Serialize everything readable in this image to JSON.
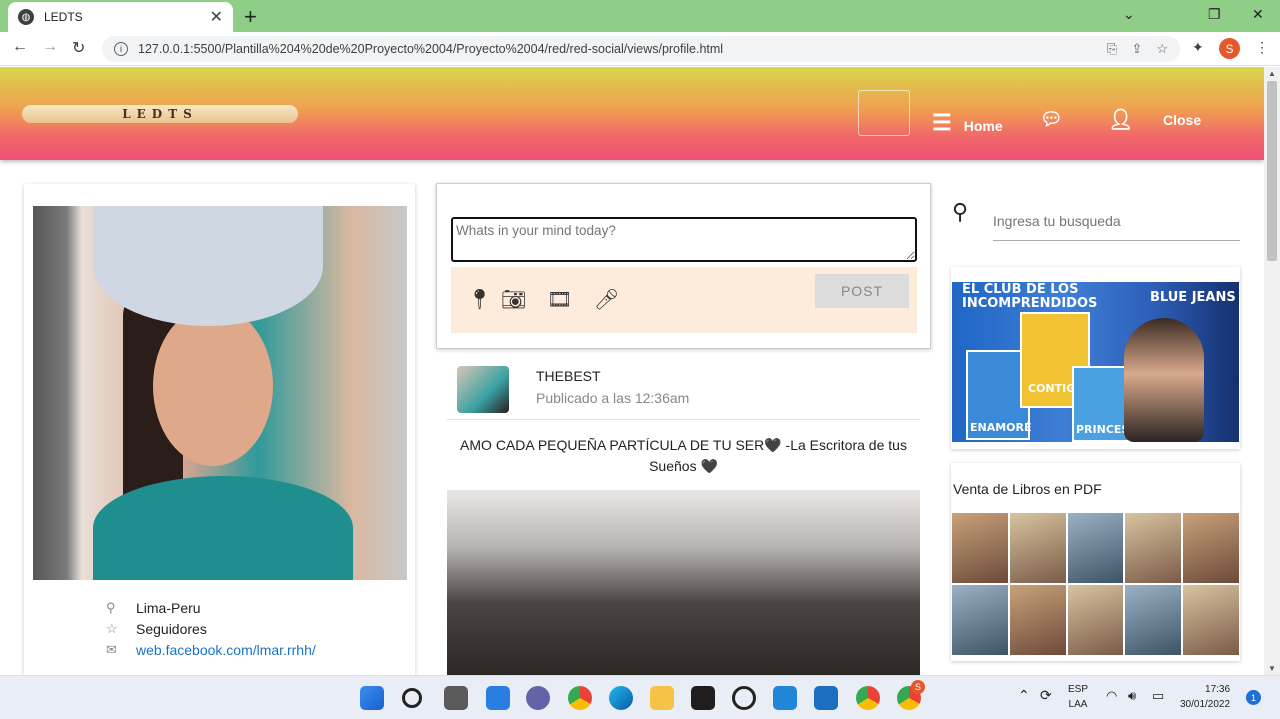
{
  "browser": {
    "tab_title": "LEDTS",
    "url": "127.0.0.1:5500/Plantilla%204%20de%20Proyecto%2004/Proyecto%2004/red/red-social/views/profile.html",
    "profile_initial": "S"
  },
  "header": {
    "logo_text": "LEDTS",
    "nav": {
      "home": "Home",
      "close": "Close"
    }
  },
  "profile": {
    "location": "Lima-Peru",
    "followers": "Seguidores",
    "link": "web.facebook.com/lmar.rrhh/"
  },
  "composer": {
    "placeholder": "Whats in your mind today?",
    "post_button": "POST"
  },
  "feed": {
    "username": "THEBEST",
    "time": "Publicado a las 12:36am",
    "text": "AMO CADA PEQUEÑA PARTÍCULA DE TU SER🖤 -La Escritora de tus Sueños 🖤"
  },
  "sidebar": {
    "search_placeholder": "Ingresa tu busqueda",
    "ad1": {
      "line1": "EL CLUB DE LOS",
      "line2": "INCOMPRENDIDOS",
      "brand": "BLUE JEANS",
      "book1": "ENAMORÉ",
      "book2": "CONTIGO?",
      "book3": "PRINCESA!"
    },
    "ad2_title": "Venta de Libros en PDF"
  },
  "taskbar": {
    "lang_top": "ESP",
    "lang_bottom": "LAA",
    "time": "17:36",
    "date": "30/01/2022",
    "notifications": "1",
    "chrome_badge": "S"
  }
}
